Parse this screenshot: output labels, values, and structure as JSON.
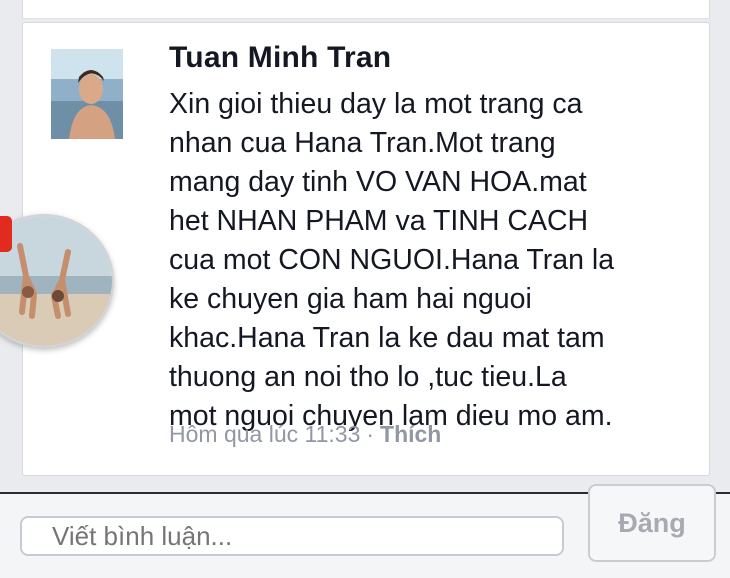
{
  "comment": {
    "author": "Tuan Minh Tran",
    "text": "Xin gioi thieu day la mot trang ca\nnhan cua Hana Tran.Mot trang\nmang day tinh VO VAN HOA.mat\nhet NHAN PHAM va TINH CACH\ncua mot CON NGUOI.Hana Tran la\nke chuyen gia ham hai nguoi\nkhac.Hana Tran la ke dau mat tam\nthuong an noi tho lo ,tuc tieu.La\nmot nguoi chuyen lam dieu mo am.",
    "timestamp": "Hôm qua lúc 11:33",
    "separator": "·",
    "like_label": "Thích"
  },
  "composer": {
    "placeholder": "Viết bình luận...",
    "post_label": "Đăng"
  },
  "colors": {
    "background": "#e9ebee",
    "text": "#141823",
    "meta": "#9197a3",
    "badge": "#e02b1e"
  },
  "icons": {
    "avatar": "profile-photo-avatar",
    "chat_head": "chat-head-avatar"
  }
}
